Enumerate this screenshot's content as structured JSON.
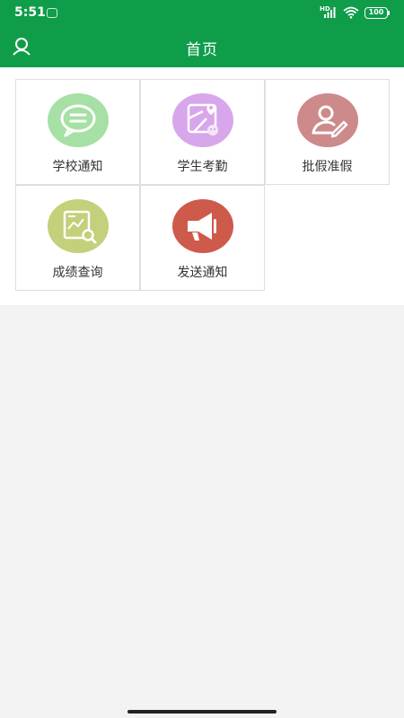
{
  "status_bar": {
    "time": "5:51",
    "network": "HD",
    "battery": "100"
  },
  "header": {
    "title": "首页"
  },
  "tiles": [
    {
      "label": "学校通知",
      "icon": "chat-bubble-icon",
      "color": "#a6e0a4"
    },
    {
      "label": "学生考勤",
      "icon": "map-pin-icon",
      "color": "#d8a6ea"
    },
    {
      "label": "批假准假",
      "icon": "user-edit-icon",
      "color": "#cc8a8a"
    },
    {
      "label": "成绩查询",
      "icon": "chart-search-icon",
      "color": "#c4d07a"
    },
    {
      "label": "发送通知",
      "icon": "megaphone-icon",
      "color": "#cd5a4a"
    }
  ],
  "colors": {
    "primary": "#0f9d4a",
    "background": "#f3f3f3",
    "panel": "#ffffff"
  }
}
